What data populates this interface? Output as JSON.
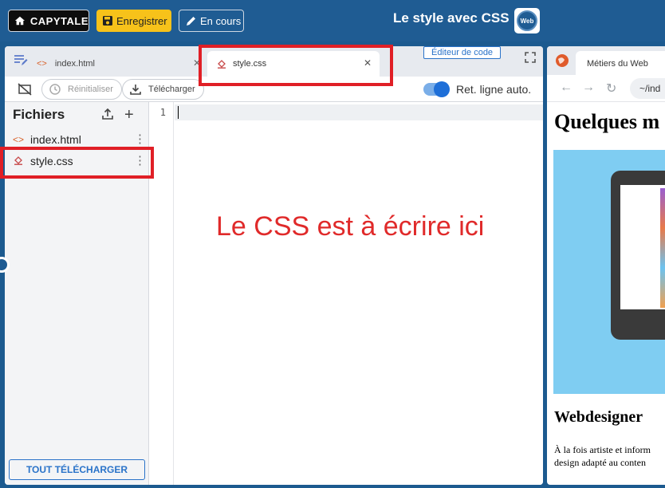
{
  "topbar": {
    "home_logo": "CAPYTALE",
    "save_label": "Enregistrer",
    "status_label": "En cours",
    "title": "Le style avec CSS",
    "badge": "Web"
  },
  "editor": {
    "tabs": [
      {
        "label": "index.html",
        "active": false
      },
      {
        "label": "style.css",
        "active": true
      }
    ],
    "editor_label": "Éditeur de code",
    "toolbar": {
      "reset_label": "Réinitialiser",
      "download_label": "Télécharger",
      "wrap_label": "Ret. ligne auto.",
      "wrap_enabled": true
    },
    "files": {
      "title": "Fichiers",
      "items": [
        {
          "name": "index.html",
          "icon": "code-icon"
        },
        {
          "name": "style.css",
          "icon": "paint-bucket-icon"
        }
      ],
      "download_all_label": "TOUT TÉLÉCHARGER"
    },
    "code": {
      "line_numbers": [
        "1"
      ],
      "annotation": "Le CSS est à écrire ici"
    }
  },
  "preview": {
    "tab_label": "Métiers du Web",
    "url": "~/ind",
    "heading": "Quelques m",
    "subheading": "Webdesigner",
    "paragraph_line1": "À la fois artiste et inform",
    "paragraph_line2": "design adapté au conten"
  },
  "colors": {
    "topbar": "#1f5c93",
    "save_button": "#f7c21a",
    "accent": "#2a73c9",
    "highlight": "#e01f26",
    "annotation": "#e02a2a"
  }
}
